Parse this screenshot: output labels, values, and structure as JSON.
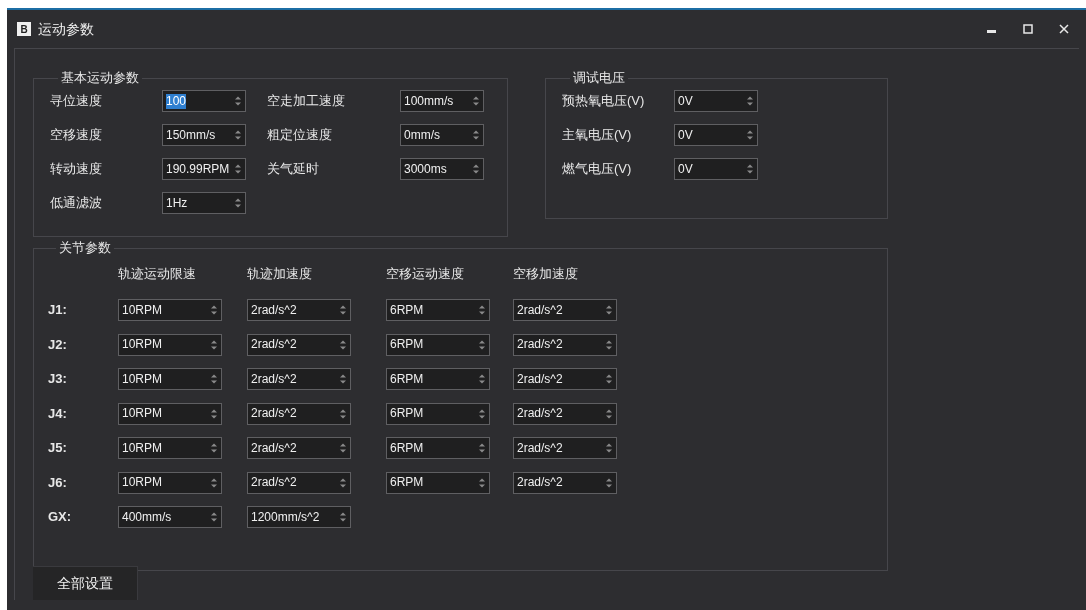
{
  "window": {
    "title": "运动参数",
    "icon_letter": "B"
  },
  "basic_motion": {
    "title": "基本运动参数",
    "left_fields": [
      {
        "label": "寻位速度",
        "value": "100",
        "text_selected": true
      },
      {
        "label": "空移速度",
        "value": "150mm/s",
        "text_selected": false
      },
      {
        "label": "转动速度",
        "value": "190.99RPM",
        "text_selected": false
      },
      {
        "label": "低通滤波",
        "value": "1Hz",
        "text_selected": false
      }
    ],
    "right_fields": [
      {
        "label": "空走加工速度",
        "value": "100mm/s",
        "text_selected": false
      },
      {
        "label": "粗定位速度",
        "value": "0mm/s",
        "text_selected": false
      },
      {
        "label": "关气延时",
        "value": "3000ms",
        "text_selected": false
      }
    ]
  },
  "test_voltage": {
    "title": "调试电压",
    "fields": [
      {
        "label": "预热氧电压(V)",
        "value": "0V",
        "text_selected": false
      },
      {
        "label": "主氧电压(V)",
        "value": "0V",
        "text_selected": false
      },
      {
        "label": "燃气电压(V)",
        "value": "0V",
        "text_selected": false
      }
    ]
  },
  "joint_params": {
    "title": "关节参数",
    "columns": [
      "轨迹运动限速",
      "轨迹加速度",
      "空移运动速度",
      "空移加速度"
    ],
    "rows": [
      {
        "label": "J1:",
        "values": [
          "10RPM",
          "2rad/s^2",
          "6RPM",
          "2rad/s^2"
        ]
      },
      {
        "label": "J2:",
        "values": [
          "10RPM",
          "2rad/s^2",
          "6RPM",
          "2rad/s^2"
        ]
      },
      {
        "label": "J3:",
        "values": [
          "10RPM",
          "2rad/s^2",
          "6RPM",
          "2rad/s^2"
        ]
      },
      {
        "label": "J4:",
        "values": [
          "10RPM",
          "2rad/s^2",
          "6RPM",
          "2rad/s^2"
        ]
      },
      {
        "label": "J5:",
        "values": [
          "10RPM",
          "2rad/s^2",
          "6RPM",
          "2rad/s^2"
        ]
      },
      {
        "label": "J6:",
        "values": [
          "10RPM",
          "2rad/s^2",
          "6RPM",
          "2rad/s^2"
        ]
      },
      {
        "label": "GX:",
        "values": [
          "400mm/s",
          "1200mm/s^2"
        ]
      }
    ]
  },
  "apply_button": {
    "label": "全部设置"
  }
}
